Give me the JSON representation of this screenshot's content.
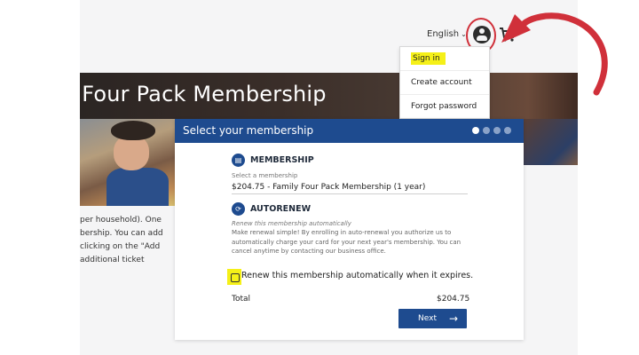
{
  "header": {
    "language": "English",
    "cart_count": "1"
  },
  "account_menu": {
    "items": [
      "Sign in",
      "Create account",
      "Forgot password"
    ]
  },
  "hero": {
    "title": "y Four Pack Membership"
  },
  "side_text": {
    "lines": [
      "per household). One",
      "bership. You can add",
      "clicking on the \"Add",
      "additional ticket"
    ]
  },
  "modal": {
    "title": "Select your membership",
    "steps": {
      "total": 4,
      "current": 1
    },
    "membership": {
      "heading": "MEMBERSHIP",
      "label": "Select a membership",
      "value": "$204.75 - Family Four Pack Membership (1 year)"
    },
    "autorenew": {
      "heading": "AUTORENEW",
      "subtitle": "Renew this membership automatically",
      "description": "Make renewal simple! By enrolling in auto-renewal you authorize us to automatically charge your card for your next year's membership. You can cancel anytime by contacting our business office.",
      "checkbox_label": "Renew this membership automatically when it expires.",
      "checked": false
    },
    "total_label": "Total",
    "total_value": "$204.75",
    "next_label": "Next"
  },
  "colors": {
    "primary": "#1e4b8f",
    "highlight": "#f5f018",
    "annotation": "#d0303a"
  },
  "icons": {
    "account": "account-circle-icon",
    "cart": "cart-icon",
    "membership": "membership-card-icon",
    "autorenew": "autorenew-icon",
    "next": "arrow-right-icon"
  }
}
